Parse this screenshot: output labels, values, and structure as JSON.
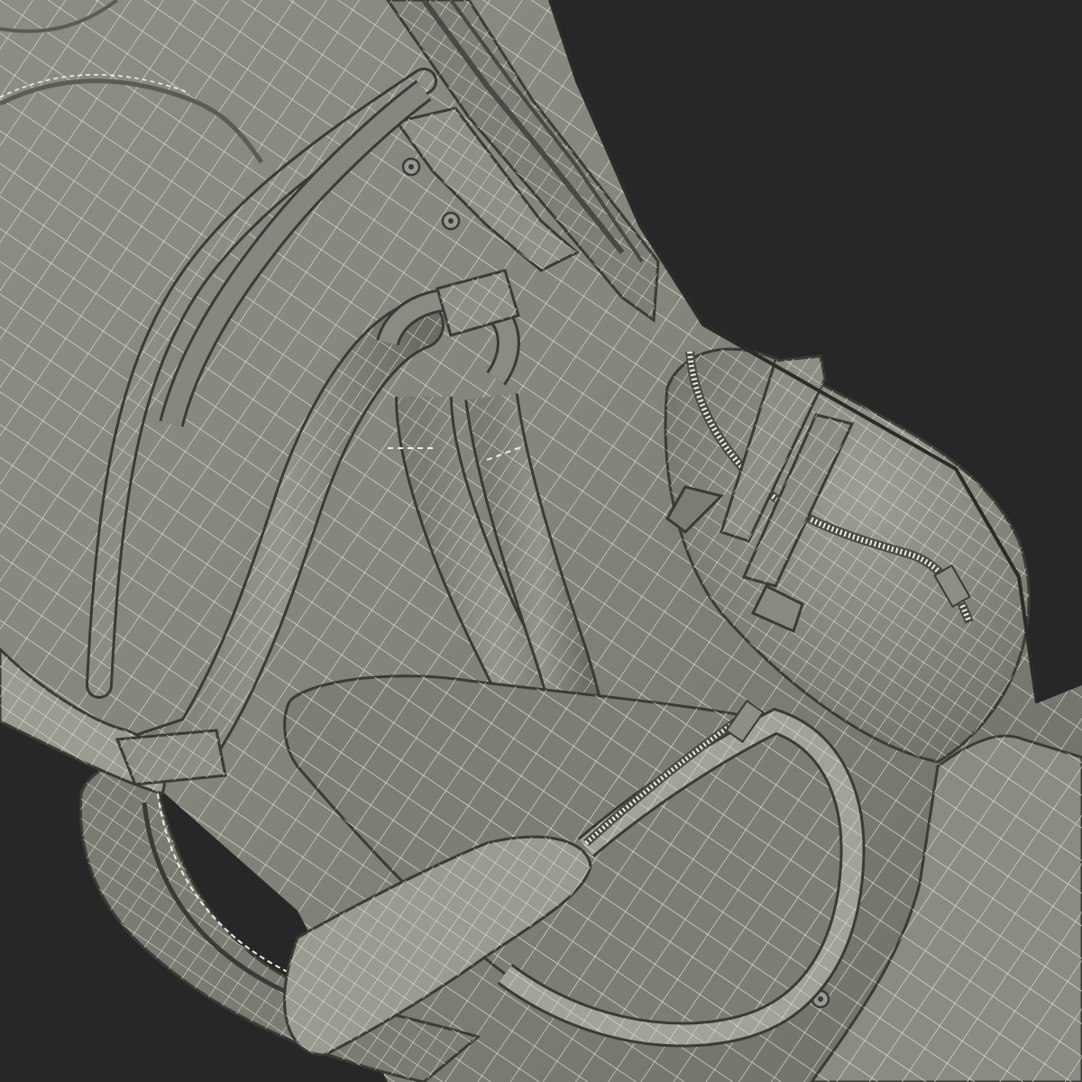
{
  "scene": {
    "subject": "golf-bag-wireframe-render",
    "colors": {
      "background": "#272727",
      "surface": "#8a8a82",
      "surface_light": "#a9a99f",
      "surface_dark": "#5e5e57",
      "wire": "#e9e7d9",
      "stitch": "#f2f0e4",
      "outline": "#3b3b36"
    },
    "icons": [
      "wireframe-mesh",
      "zipper",
      "rivet",
      "strap",
      "handle",
      "pocket",
      "stand-leg"
    ]
  }
}
